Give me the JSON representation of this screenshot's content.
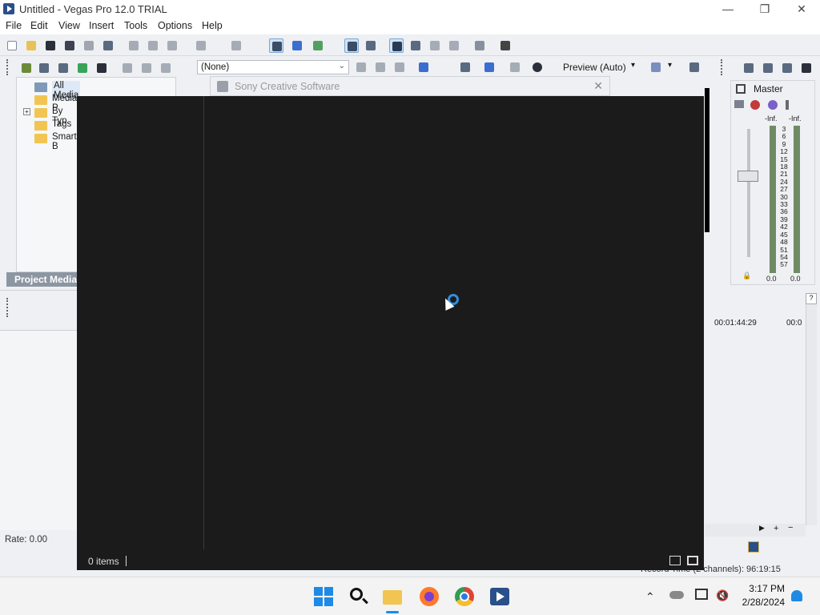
{
  "window": {
    "title": "Untitled - Vegas Pro 12.0 TRIAL"
  },
  "menu": [
    "File",
    "Edit",
    "View",
    "Insert",
    "Tools",
    "Options",
    "Help"
  ],
  "explorer": {
    "items": [
      "All Media",
      "Media P",
      "By Typ",
      "Tags",
      "Smart B"
    ],
    "tab_label": "Project Media"
  },
  "preview": {
    "dropdown_value": "(None)",
    "mode_label": "Preview (Auto)"
  },
  "mixer": {
    "title": "Master",
    "left_peak": "-Inf.",
    "right_peak": "-Inf.",
    "scale": [
      "3",
      "6",
      "9",
      "12",
      "15",
      "18",
      "21",
      "24",
      "27",
      "30",
      "33",
      "36",
      "39",
      "42",
      "45",
      "48",
      "51",
      "54",
      "57"
    ],
    "left_value": "0.0",
    "right_value": "0.0"
  },
  "timeline": {
    "time_a": "00:01:44:29",
    "time_b": "00:0"
  },
  "status": {
    "rate": "Rate: 0.00",
    "record_time": "Record Time (2 channels): 96:19:15"
  },
  "dialog": {
    "title": "Sony Creative Software",
    "items_count": "0 items"
  },
  "tray": {
    "time": "3:17 PM",
    "date": "2/28/2024"
  },
  "colors": {
    "accent": "#2f8ee0",
    "dark_bg": "#1b1b1b"
  }
}
